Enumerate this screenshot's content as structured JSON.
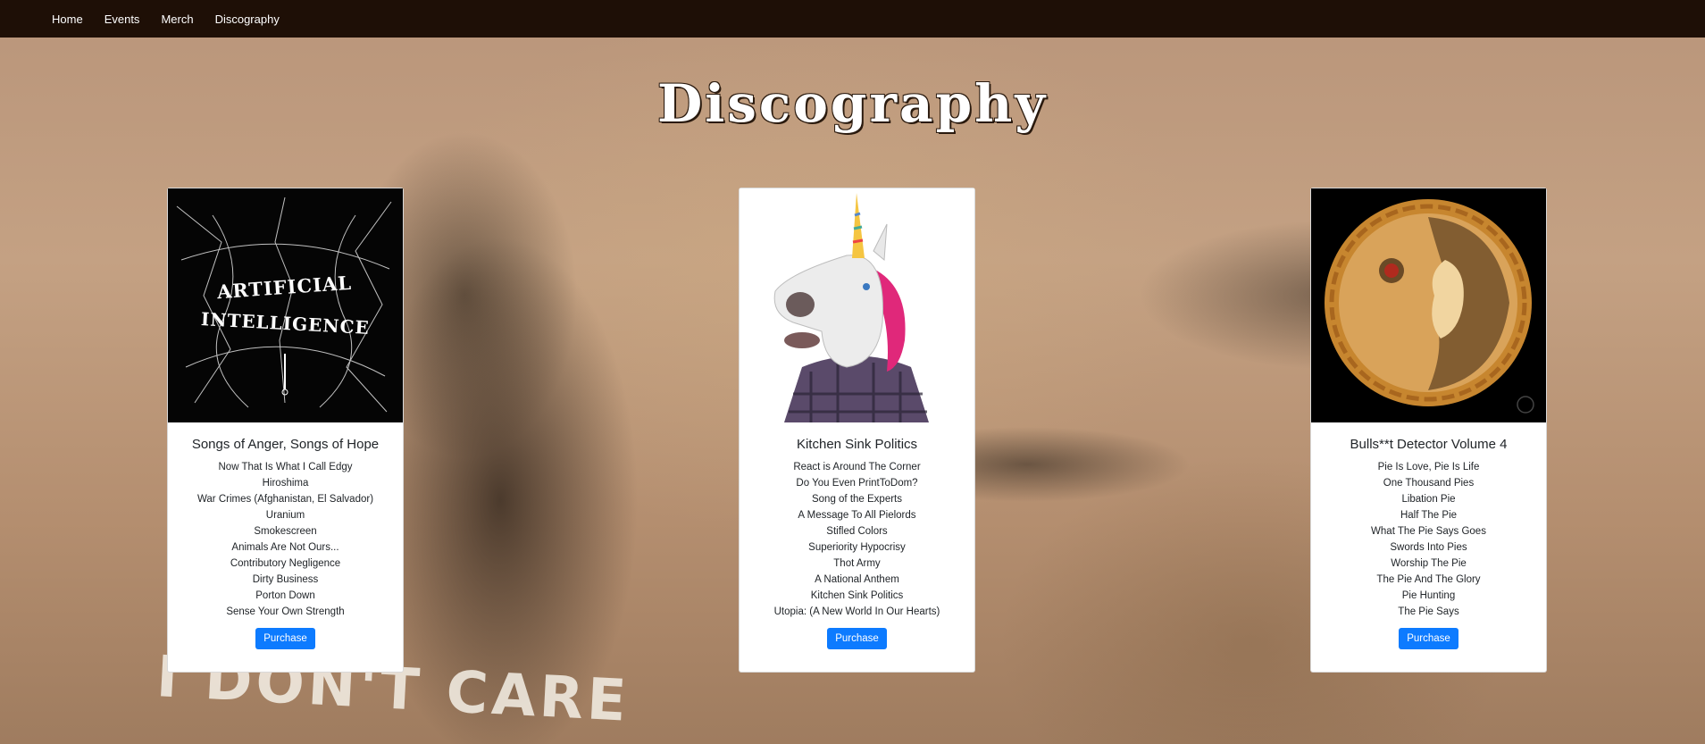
{
  "nav": {
    "items": [
      {
        "label": "Home"
      },
      {
        "label": "Events"
      },
      {
        "label": "Merch"
      },
      {
        "label": "Discography"
      }
    ]
  },
  "page": {
    "title": "Discography",
    "background_graffiti": "I DON'T CARE"
  },
  "albums": [
    {
      "title": "Songs of Anger, Songs of Hope",
      "cover_text": "ARTIFICIAL INTELLIGENCE",
      "tracks": [
        "Now That Is What I Call Edgy",
        "Hiroshima",
        "War Crimes (Afghanistan, El Salvador)",
        "Uranium",
        "Smokescreen",
        "Animals Are Not Ours...",
        "Contributory Negligence",
        "Dirty Business",
        "Porton Down",
        "Sense Your Own Strength"
      ],
      "button": "Purchase"
    },
    {
      "title": "Kitchen Sink Politics",
      "tracks": [
        "React is Around The Corner",
        "Do You Even PrintToDom?",
        "Song of the Experts",
        "A Message To All Pielords",
        "Stifled Colors",
        "Superiority Hypocrisy",
        "Thot Army",
        "A National Anthem",
        "Kitchen Sink Politics",
        "Utopia: (A New World In Our Hearts)"
      ],
      "button": "Purchase"
    },
    {
      "title": "Bulls**t Detector Volume 4",
      "tracks": [
        "Pie Is Love, Pie Is Life",
        "One Thousand Pies",
        "Libation Pie",
        "Half The Pie",
        "What The Pie Says Goes",
        "Swords Into Pies",
        "Worship The Pie",
        "The Pie And The Glory",
        "Pie Hunting",
        "The Pie Says"
      ],
      "button": "Purchase"
    }
  ],
  "colors": {
    "navbar": "#1e0f06",
    "button": "#0d7bff"
  }
}
